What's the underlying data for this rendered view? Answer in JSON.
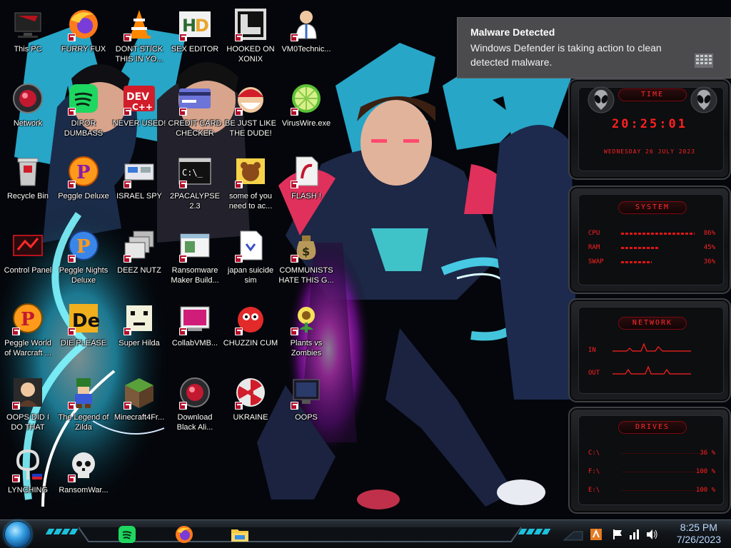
{
  "desktop": {
    "icons": [
      {
        "label": "This PC",
        "icon": "monitor-dark-icon"
      },
      {
        "label": "FURRY FUX",
        "icon": "firefox-icon"
      },
      {
        "label": "DONT STICK THIS IN YO...",
        "icon": "vlc-cone-icon"
      },
      {
        "label": "SEX EDITOR",
        "icon": "hxd-icon"
      },
      {
        "label": "HOOKED ON XONIX",
        "icon": "xonix-icon"
      },
      {
        "label": "VM0Technic...",
        "icon": "doctor-icon"
      },
      {
        "label": "Network",
        "icon": "red-orb-icon"
      },
      {
        "label": "DIPOR DUMBASS",
        "icon": "spotify-icon"
      },
      {
        "label": "NEVER USED!",
        "icon": "devcpp-icon"
      },
      {
        "label": "CREDIT CARD CHECKER",
        "icon": "credit-card-icon"
      },
      {
        "label": "BE JUST LIKE THE DUDE!",
        "icon": "santa-icon"
      },
      {
        "label": "VirusWire.exe",
        "icon": "lime-icon"
      },
      {
        "label": "Recycle Bin",
        "icon": "recycle-bin-icon"
      },
      {
        "label": "Peggle Deluxe",
        "icon": "peggle-icon"
      },
      {
        "label": "ISRAEL SPY",
        "icon": "network-card-icon"
      },
      {
        "label": "2PACALYPSE 2.3",
        "icon": "cmd-icon"
      },
      {
        "label": "some of you need to ac...",
        "icon": "bear-icon"
      },
      {
        "label": "FLASH !",
        "icon": "flash-doc-icon"
      },
      {
        "label": "Control Panel",
        "icon": "control-panel-icon"
      },
      {
        "label": "Peggle Nights Deluxe",
        "icon": "peggle-nights-icon"
      },
      {
        "label": "DEEZ NUTZ",
        "icon": "windows-stack-icon"
      },
      {
        "label": "Ransomware Maker Build...",
        "icon": "window-app-icon"
      },
      {
        "label": "japan suicide sim",
        "icon": "document-icon"
      },
      {
        "label": "COMMUNISTS HATE THIS G...",
        "icon": "money-bag-icon"
      },
      {
        "label": "Peggle World of Warcraft ...",
        "icon": "peggle-wow-icon"
      },
      {
        "label": "DIE PLEASE",
        "icon": "de-icon"
      },
      {
        "label": "Super Hilda",
        "icon": "pixel-face-icon"
      },
      {
        "label": "CollabVMB...",
        "icon": "collabvm-icon"
      },
      {
        "label": "CHUZZIN CUM",
        "icon": "chuzzle-icon"
      },
      {
        "label": "Plants vs Zombies",
        "icon": "pvz-icon"
      },
      {
        "label": "OOPS DID I DO THAT",
        "icon": "portrait-icon"
      },
      {
        "label": "The Legend of Zilda",
        "icon": "pixel-hero-icon"
      },
      {
        "label": "Minecraft4Fr...",
        "icon": "minecraft-block-icon"
      },
      {
        "label": "Download Black Ali...",
        "icon": "red-orb-icon"
      },
      {
        "label": "UKRAINE",
        "icon": "radiation-icon"
      },
      {
        "label": "OOPS",
        "icon": "dark-monitor-icon"
      },
      {
        "label": "LYNCHING",
        "icon": "lynch-icon"
      },
      {
        "label": "RansomWar...",
        "icon": "skull-icon"
      }
    ]
  },
  "notification": {
    "title": "Malware Detected",
    "body": "Windows Defender is taking action to clean detected malware.",
    "icon": "defender-grid-icon"
  },
  "widgets": {
    "time": {
      "badge": "TIME",
      "clock": "20:25:01",
      "date": "WEDNESDAY 26 JULY 2023"
    },
    "system": {
      "badge": "SYSTEM",
      "rows": [
        {
          "label": "CPU",
          "value": "86%",
          "fill": 0.86
        },
        {
          "label": "RAM",
          "value": "45%",
          "fill": 0.45
        },
        {
          "label": "SWAP",
          "value": "36%",
          "fill": 0.36
        }
      ]
    },
    "network": {
      "badge": "NETWORK",
      "in_label": "IN",
      "out_label": "OUT"
    },
    "drives": {
      "badge": "DRIVES",
      "rows": [
        {
          "label": "C:\\",
          "value": "36 %"
        },
        {
          "label": "F:\\",
          "value": "100 %"
        },
        {
          "label": "E:\\",
          "value": "100 %"
        }
      ]
    }
  },
  "taskbar": {
    "apps": [
      "spotify-icon",
      "firefox-icon",
      "file-explorer-icon"
    ],
    "tray": [
      "ime-icon",
      "arrow-icon",
      "flag-icon",
      "network-icon",
      "volume-icon"
    ],
    "time": "8:25 PM",
    "date": "7/26/2023"
  },
  "colors": {
    "widget_red": "#ff2020",
    "taskbar_accent": "#1de0ff",
    "clock_text": "#b8d8ff"
  }
}
